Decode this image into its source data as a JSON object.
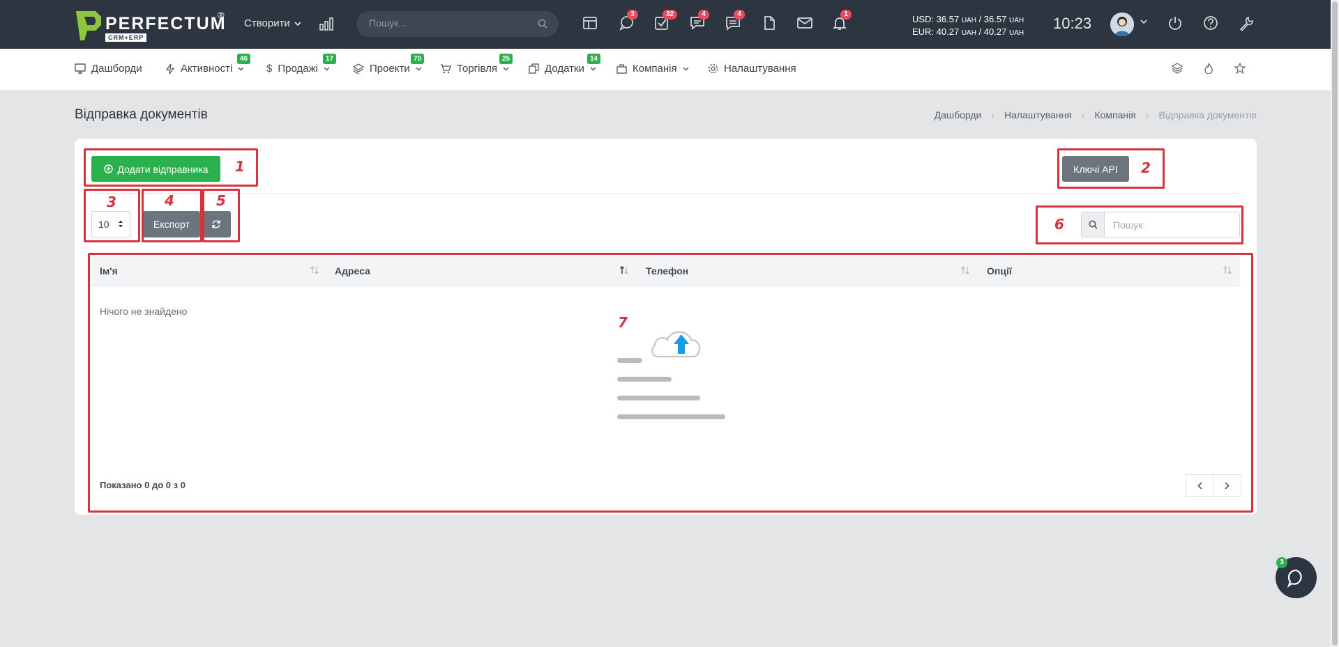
{
  "header": {
    "logo_text": "PERFECTUM",
    "logo_reg": "®",
    "logo_sub": "CRM+ERP",
    "create_label": "Створити",
    "search_placeholder": "Пошук...",
    "badges": {
      "chat": "3",
      "tasks": "32",
      "messages": "4",
      "comments": "4",
      "notifications": "1"
    },
    "usd_rate": "USD: 36.57",
    "usd_rate2": "36.57",
    "eur_rate": "EUR: 40.27",
    "eur_rate2": "40.27",
    "currency": "UAH",
    "clock": "10:23"
  },
  "nav": {
    "items": [
      {
        "label": "Дашборди",
        "icon": "monitor-icon"
      },
      {
        "label": "Активності",
        "badge": "46"
      },
      {
        "label": "Продажі",
        "badge": "17"
      },
      {
        "label": "Проекти",
        "badge": "70"
      },
      {
        "label": "Торгівля",
        "badge": "25"
      },
      {
        "label": "Додатки",
        "badge": "14"
      },
      {
        "label": "Компанія"
      },
      {
        "label": "Налаштування"
      }
    ]
  },
  "page": {
    "title": "Відправка документів",
    "breadcrumb": [
      "Дашборди",
      "Налаштування",
      "Компанія",
      "Відправка документів"
    ]
  },
  "toolbar": {
    "add_label": "Додати відправника",
    "api_label": "Ключі API",
    "page_size": "10",
    "export_label": "Експорт",
    "search_placeholder": "Пошук:"
  },
  "table": {
    "columns": [
      "Ім'я",
      "Адреса",
      "Телефон",
      "Опції"
    ],
    "empty_text": "Нічого не знайдено",
    "info": "Показано 0 до 0 з 0"
  },
  "annotations": [
    "1",
    "2",
    "3",
    "4",
    "5",
    "6",
    "7"
  ],
  "chat": {
    "badge": "3"
  },
  "colors": {
    "header_bg": "#2c3540",
    "green": "#2bb04e",
    "badge_red": "#e84b5d",
    "annotation_red": "#d5333e",
    "gray_btn": "#6c757d",
    "upload_blue": "#1a9be6"
  }
}
